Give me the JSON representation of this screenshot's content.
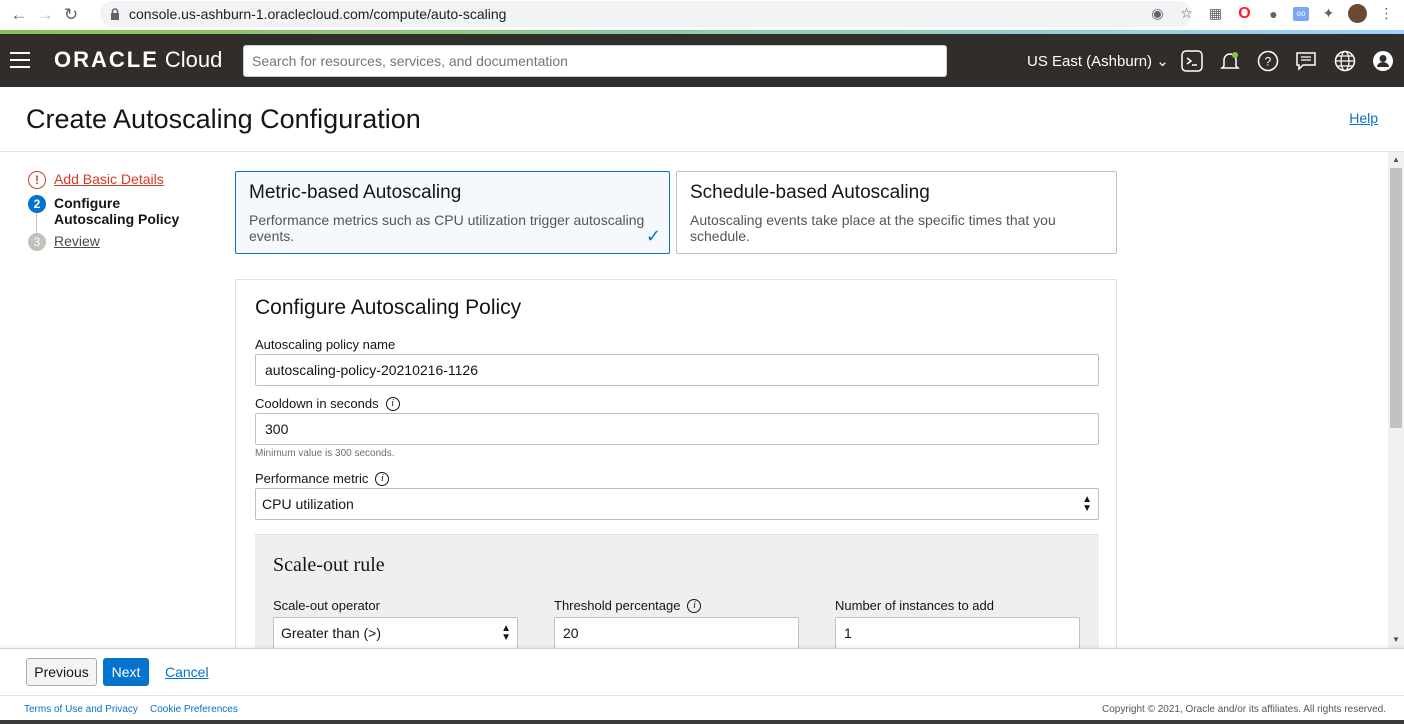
{
  "browser": {
    "url": "console.us-ashburn-1.oraclecloud.com/compute/auto-scaling"
  },
  "header": {
    "brand_oracle": "ORACLE",
    "brand_cloud": "Cloud",
    "search_placeholder": "Search for resources, services, and documentation",
    "region": "US East (Ashburn)"
  },
  "page": {
    "title": "Create Autoscaling Configuration",
    "help": "Help"
  },
  "steps": [
    {
      "num": "!",
      "label": "Add Basic Details",
      "state": "error"
    },
    {
      "num": "2",
      "label": "Configure Autoscaling Policy",
      "state": "current"
    },
    {
      "num": "3",
      "label": "Review",
      "state": "future"
    }
  ],
  "cards": {
    "metric": {
      "title": "Metric-based Autoscaling",
      "desc": "Performance metrics such as CPU utilization trigger autoscaling events."
    },
    "schedule": {
      "title": "Schedule-based Autoscaling",
      "desc": "Autoscaling events take place at the specific times that you schedule."
    }
  },
  "form": {
    "title": "Configure Autoscaling Policy",
    "policy_name_label": "Autoscaling policy name",
    "policy_name_value": "autoscaling-policy-20210216-1126",
    "cooldown_label": "Cooldown in seconds",
    "cooldown_value": "300",
    "cooldown_helper": "Minimum value is 300 seconds.",
    "metric_label": "Performance metric",
    "metric_value": "CPU utilization",
    "scale_out": {
      "title": "Scale-out rule",
      "operator_label": "Scale-out operator",
      "operator_value": "Greater than (>)",
      "threshold_label": "Threshold percentage",
      "threshold_value": "20",
      "instances_label": "Number of instances to add",
      "instances_value": "1"
    }
  },
  "actions": {
    "previous": "Previous",
    "next": "Next",
    "cancel": "Cancel"
  },
  "footer": {
    "terms": "Terms of Use and Privacy",
    "cookies": "Cookie Preferences",
    "copyright": "Copyright © 2021, Oracle and/or its affiliates. All rights reserved."
  },
  "colors": {
    "header_bg": "#312d2a",
    "accent_blue": "#0572ce",
    "error_red": "#d63b25"
  }
}
